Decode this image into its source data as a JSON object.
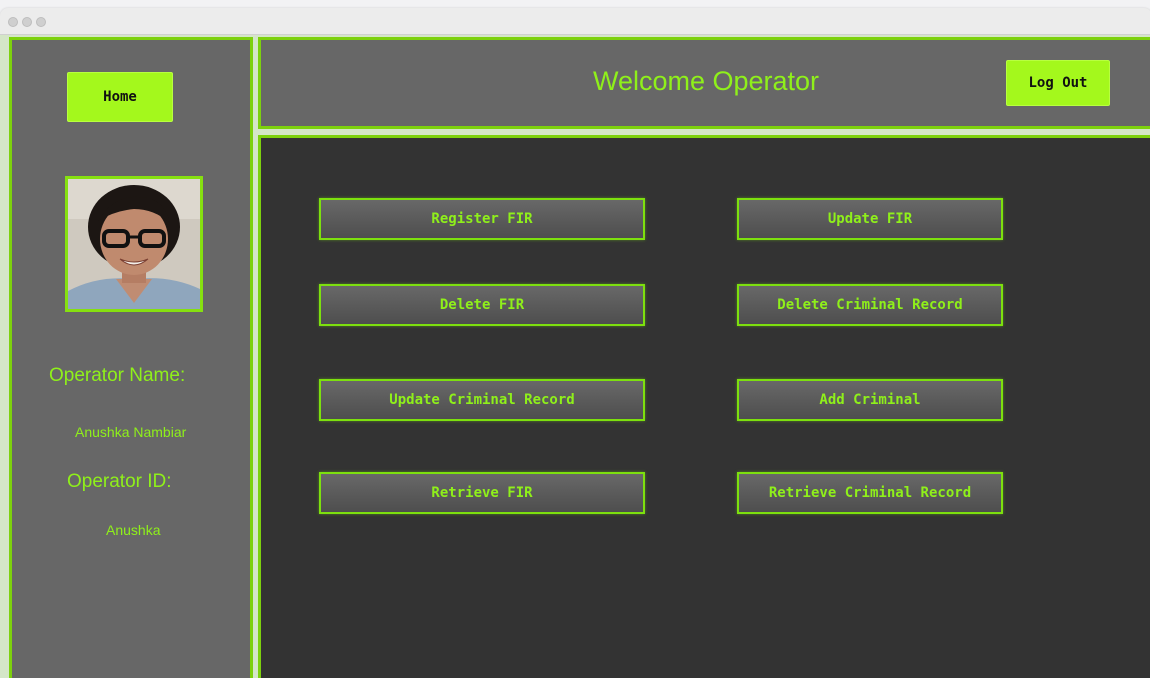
{
  "header": {
    "title": "Welcome Operator",
    "logout_label": "Log Out"
  },
  "sidebar": {
    "home_label": "Home",
    "operator_name_label": "Operator Name:",
    "operator_name_value": "Anushka Nambiar",
    "operator_id_label": "Operator ID:",
    "operator_id_value": "Anushka"
  },
  "actions": {
    "register_fir": "Register FIR",
    "update_fir": "Update FIR",
    "delete_fir": "Delete FIR",
    "delete_criminal_record": "Delete Criminal Record",
    "update_criminal_record": "Update Criminal Record",
    "add_criminal": "Add Criminal",
    "retrieve_fir": "Retrieve FIR",
    "retrieve_criminal_record": "Retrieve Criminal Record"
  },
  "colors": {
    "accent": "#8ff01a",
    "border": "#7dd10d",
    "panel": "#676767",
    "main_bg": "#333333"
  }
}
